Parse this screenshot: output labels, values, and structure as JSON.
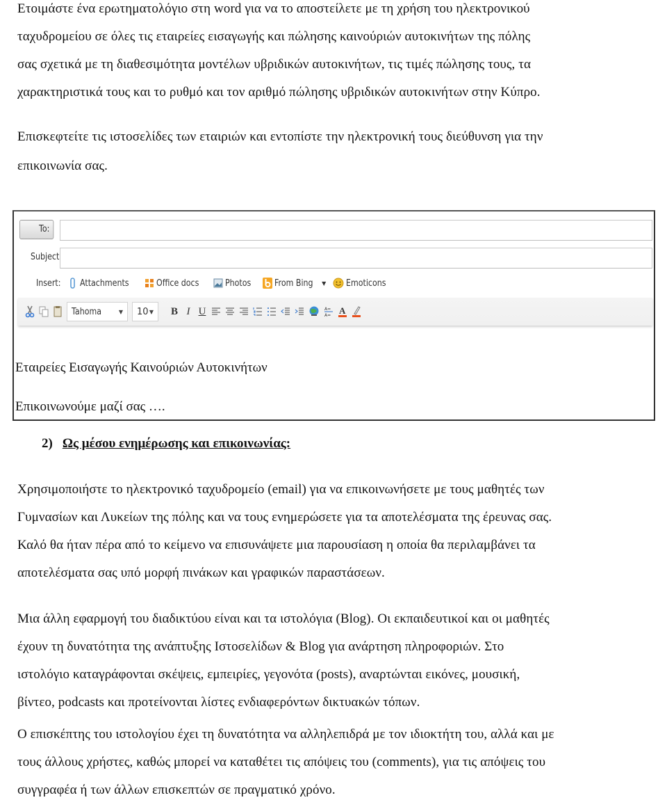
{
  "intro": {
    "lines": [
      "Ετοιμάστε ένα ερωτηματολόγιο στη word για να το αποστείλετε με τη χρήση του ηλεκτρονικού",
      "ταχυδρομείου σε όλες τις εταιρείες εισαγωγής και πώλησης καινούριών αυτοκινήτων της πόλης",
      "σας σχετικά με τη διαθεσιμότητα μοντέλων υβριδικών αυτοκινήτων, τις τιμές πώλησης τους, τα",
      "χαρακτηριστικά τους και το ρυθμό και τον αριθμό πώλησης υβριδικών αυτοκινήτων στην Κύπρο."
    ]
  },
  "visit": {
    "lines": [
      "Επισκεφτείτε τις ιστοσελίδες των εταιριών και εντοπίστε την ηλεκτρονική τους διεύθυνση για την",
      "επικοινωνία σας."
    ]
  },
  "compose": {
    "to_label": "To:",
    "to_value": "",
    "subject_label": "Subject:",
    "subject_value": "",
    "insert_label": "Insert:",
    "insert_items": [
      "Attachments",
      "Office docs",
      "Photos",
      "From Bing",
      "Emoticons"
    ],
    "font_name": "Tahoma",
    "font_size": "10",
    "format_buttons": [
      "B",
      "I",
      "U"
    ],
    "body_lines": [
      "Εταιρείες Εισαγωγής Καινούριών Αυτοκινήτων",
      "Επικοινωνούμε μαζί σας …."
    ]
  },
  "section2": {
    "number": "2)",
    "title": "Ως μέσου ενημέρωσης και επικοινωνίας:"
  },
  "para1": {
    "lines": [
      "Χρησιμοποιήστε το ηλεκτρονικό ταχυδρομείο (email) για να επικοινωνήσετε με τους μαθητές των",
      "Γυμνασίων και Λυκείων της πόλης και να τους ενημερώσετε για τα αποτελέσματα της έρευνας σας.",
      "Καλό θα ήταν πέρα από το κείμενο να επισυνάψετε μια παρουσίαση η οποία θα περιλαμβάνει τα",
      "αποτελέσματα σας υπό μορφή πινάκων και γραφικών παραστάσεων."
    ]
  },
  "para2": {
    "lines": [
      "Μια άλλη εφαρμογή του διαδικτύου είναι και τα ιστολόγια (Blog). Οι εκπαιδευτικοί και οι μαθητές",
      "έχουν τη δυνατότητα της ανάπτυξης Ιστοσελίδων & Blog για ανάρτηση πληροφοριών. Στο",
      "ιστολόγιο καταγράφονται σκέψεις, εμπειρίες, γεγονότα  (posts), αναρτώνται εικόνες, μουσική,",
      "βίντεο, podcasts και προτείνονται λίστες ενδιαφερόντων δικτυακών τόπων."
    ]
  },
  "para3": {
    "lines": [
      "Ο επισκέπτης του ιστολογίου έχει τη δυνατότητα να αλληλεπιδρά με τον ιδιοκτήτη του, αλλά και με",
      "τους άλλους χρήστες, καθώς μπορεί να καταθέτει τις απόψεις του (comments), για τις απόψεις του",
      "συγγραφέα ή των άλλων  επισκεπτών σε πραγματικό χρόνο."
    ]
  },
  "colors": {
    "text": "#111111",
    "attachment_icon": "#5b9bd5",
    "office_icon": "#f0a030",
    "bing_icon": "#f5a623",
    "emoticon_icon": "#f2c12e",
    "font_color_bar": "#e8501c"
  }
}
